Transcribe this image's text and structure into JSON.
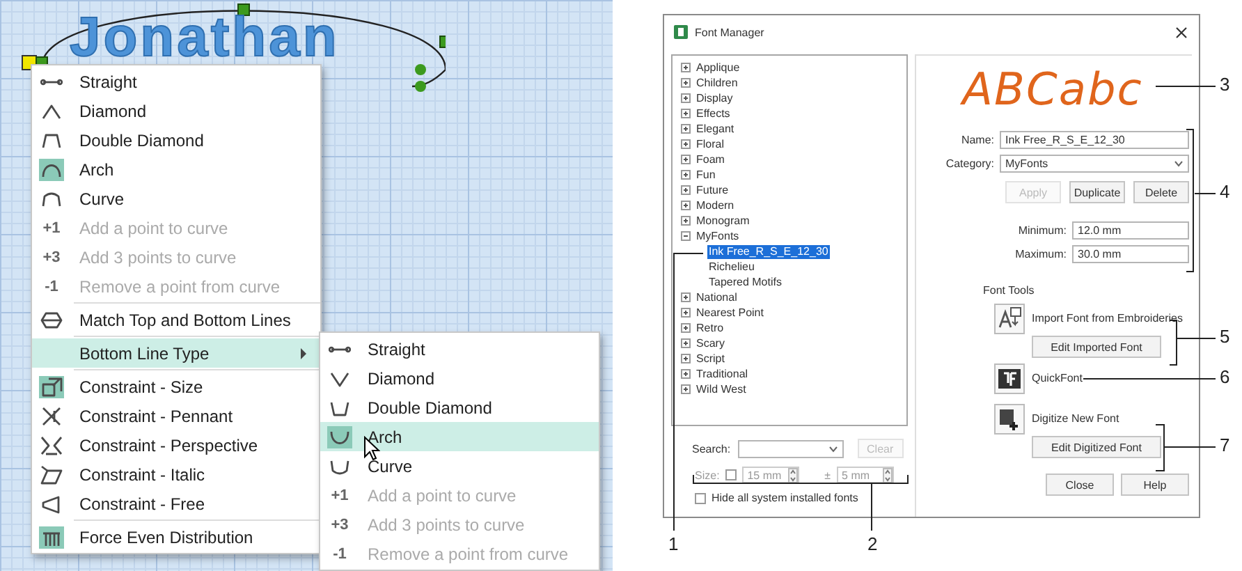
{
  "canvas": {
    "design_text": "Jonathan"
  },
  "context_menu": {
    "items": [
      {
        "kind": "icon",
        "label": "Straight",
        "disabled": false,
        "checked": false,
        "selected": false
      },
      {
        "kind": "icon",
        "label": "Diamond",
        "disabled": false,
        "checked": false,
        "selected": false
      },
      {
        "kind": "icon",
        "label": "Double Diamond",
        "disabled": false,
        "checked": false,
        "selected": false
      },
      {
        "kind": "icon",
        "label": "Arch",
        "disabled": false,
        "checked": true,
        "selected": false
      },
      {
        "kind": "icon",
        "label": "Curve",
        "disabled": false,
        "checked": false,
        "selected": false
      },
      {
        "kind": "step",
        "step": "+1",
        "label": "Add a point to curve",
        "disabled": true,
        "selected": false
      },
      {
        "kind": "step",
        "step": "+3",
        "label": "Add 3 points to curve",
        "disabled": true,
        "selected": false
      },
      {
        "kind": "step",
        "step": "-1",
        "label": "Remove a point from curve",
        "disabled": true,
        "selected": false
      },
      {
        "kind": "separator"
      },
      {
        "kind": "icon",
        "label": "Match Top and Bottom Lines",
        "disabled": false,
        "checked": false,
        "selected": false
      },
      {
        "kind": "separator"
      },
      {
        "kind": "submenu",
        "label": "Bottom Line Type",
        "disabled": false,
        "selected": true
      },
      {
        "kind": "separator"
      },
      {
        "kind": "icon",
        "label": "Constraint - Size",
        "disabled": false,
        "checked": true,
        "selected": false
      },
      {
        "kind": "icon",
        "label": "Constraint - Pennant",
        "disabled": false,
        "checked": false,
        "selected": false
      },
      {
        "kind": "icon",
        "label": "Constraint - Perspective",
        "disabled": false,
        "checked": false,
        "selected": false
      },
      {
        "kind": "icon",
        "label": "Constraint - Italic",
        "disabled": false,
        "checked": false,
        "selected": false
      },
      {
        "kind": "icon",
        "label": "Constraint - Free",
        "disabled": false,
        "checked": false,
        "selected": false
      },
      {
        "kind": "separator"
      },
      {
        "kind": "icon",
        "label": "Force Even Distribution",
        "disabled": false,
        "checked": true,
        "selected": false
      }
    ]
  },
  "submenu": {
    "items": [
      {
        "kind": "icon",
        "label": "Straight",
        "disabled": false,
        "checked": false,
        "selected": false
      },
      {
        "kind": "icon",
        "label": "Diamond",
        "disabled": false,
        "checked": false,
        "selected": false
      },
      {
        "kind": "icon",
        "label": "Double Diamond",
        "disabled": false,
        "checked": false,
        "selected": false
      },
      {
        "kind": "icon",
        "label": "Arch",
        "disabled": false,
        "checked": true,
        "selected": true
      },
      {
        "kind": "icon",
        "label": "Curve",
        "disabled": false,
        "checked": false,
        "selected": false
      },
      {
        "kind": "step",
        "step": "+1",
        "label": "Add a point to curve",
        "disabled": true,
        "selected": false
      },
      {
        "kind": "step",
        "step": "+3",
        "label": "Add 3 points to curve",
        "disabled": true,
        "selected": false
      },
      {
        "kind": "step",
        "step": "-1",
        "label": "Remove a point from curve",
        "disabled": true,
        "selected": false
      }
    ]
  },
  "font_manager": {
    "title": "Font Manager",
    "tree": [
      {
        "label": "Applique",
        "expanded": false
      },
      {
        "label": "Children",
        "expanded": false
      },
      {
        "label": "Display",
        "expanded": false
      },
      {
        "label": "Effects",
        "expanded": false
      },
      {
        "label": "Elegant",
        "expanded": false
      },
      {
        "label": "Floral",
        "expanded": false
      },
      {
        "label": "Foam",
        "expanded": false
      },
      {
        "label": "Fun",
        "expanded": false
      },
      {
        "label": "Future",
        "expanded": false
      },
      {
        "label": "Modern",
        "expanded": false
      },
      {
        "label": "Monogram",
        "expanded": false
      },
      {
        "label": "MyFonts",
        "expanded": true,
        "children": [
          {
            "label": "Ink Free_R_S_E_12_30",
            "selected": true
          },
          {
            "label": "Richelieu",
            "selected": false
          },
          {
            "label": "Tapered Motifs",
            "selected": false
          }
        ]
      },
      {
        "label": "National",
        "expanded": false
      },
      {
        "label": "Nearest Point",
        "expanded": false
      },
      {
        "label": "Retro",
        "expanded": false
      },
      {
        "label": "Scary",
        "expanded": false
      },
      {
        "label": "Script",
        "expanded": false
      },
      {
        "label": "Traditional",
        "expanded": false
      },
      {
        "label": "Wild West",
        "expanded": false
      }
    ],
    "search": {
      "label": "Search:"
    },
    "clear_button": {
      "label": "Clear",
      "disabled": true
    },
    "size": {
      "label": "Size:",
      "checked": false,
      "value": "15 mm",
      "tolerance_symbol": "±",
      "tolerance": "5 mm"
    },
    "hide_system_fonts": {
      "label": "Hide all system installed fonts",
      "checked": false
    },
    "preview": "ABCabc",
    "name": {
      "label": "Name:",
      "value": "Ink Free_R_S_E_12_30"
    },
    "category": {
      "label": "Category:",
      "value": "MyFonts"
    },
    "actions": [
      {
        "label": "Apply",
        "disabled": true
      },
      {
        "label": "Duplicate",
        "disabled": false
      },
      {
        "label": "Delete",
        "disabled": false
      }
    ],
    "minimum": {
      "label": "Minimum:",
      "value": "12.0 mm"
    },
    "maximum": {
      "label": "Maximum:",
      "value": "30.0 mm"
    },
    "font_tools": {
      "title": "Font Tools",
      "tools": [
        {
          "label": "Import Font from Embroideries",
          "button": "Edit Imported Font"
        },
        {
          "label": "QuickFont"
        },
        {
          "label": "Digitize New Font",
          "button": "Edit Digitized Font"
        }
      ]
    },
    "buttons": [
      {
        "label": "Close"
      },
      {
        "label": "Help"
      }
    ]
  },
  "callouts": [
    {
      "number": "1"
    },
    {
      "number": "2"
    },
    {
      "number": "3"
    },
    {
      "number": "4"
    },
    {
      "number": "5"
    },
    {
      "number": "6"
    },
    {
      "number": "7"
    }
  ]
}
